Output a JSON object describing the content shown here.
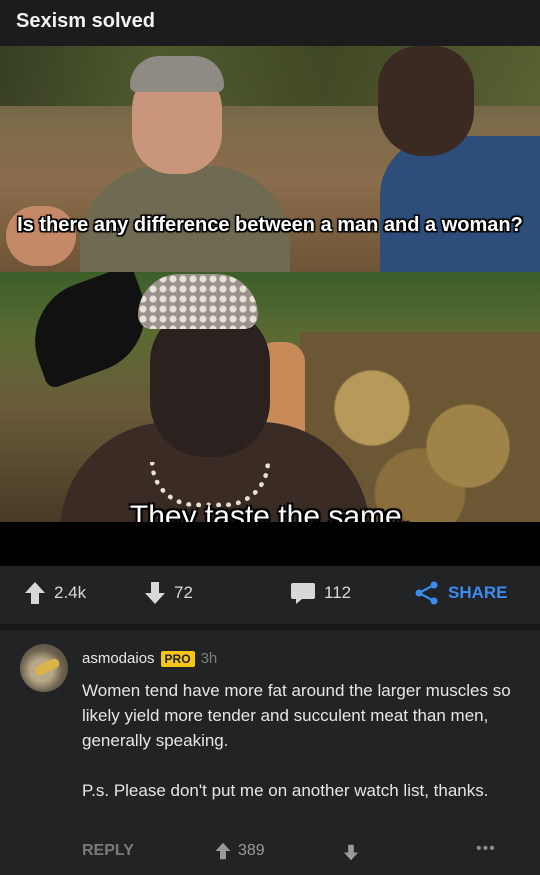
{
  "post": {
    "title": "Sexism solved",
    "subtitles": {
      "line1": "Is there any difference between a man and a woman?",
      "line2": "They taste the same."
    }
  },
  "actions": {
    "upvotes": "2.4k",
    "downvotes": "72",
    "comments": "112",
    "share_label": "SHARE"
  },
  "comment": {
    "username": "asmodaios",
    "badge": "PRO",
    "time": "3h",
    "paragraphs": [
      "Women tend have more fat around the larger muscles so likely yield more tender and succulent meat than men, generally speaking.",
      "P.s. Please don't put me on another watch list, thanks."
    ],
    "reply_label": "REPLY",
    "score": "389",
    "more_label": "•••"
  },
  "colors": {
    "background": "#222325",
    "accent": "#3b8cf0",
    "badge": "#f5c518"
  }
}
